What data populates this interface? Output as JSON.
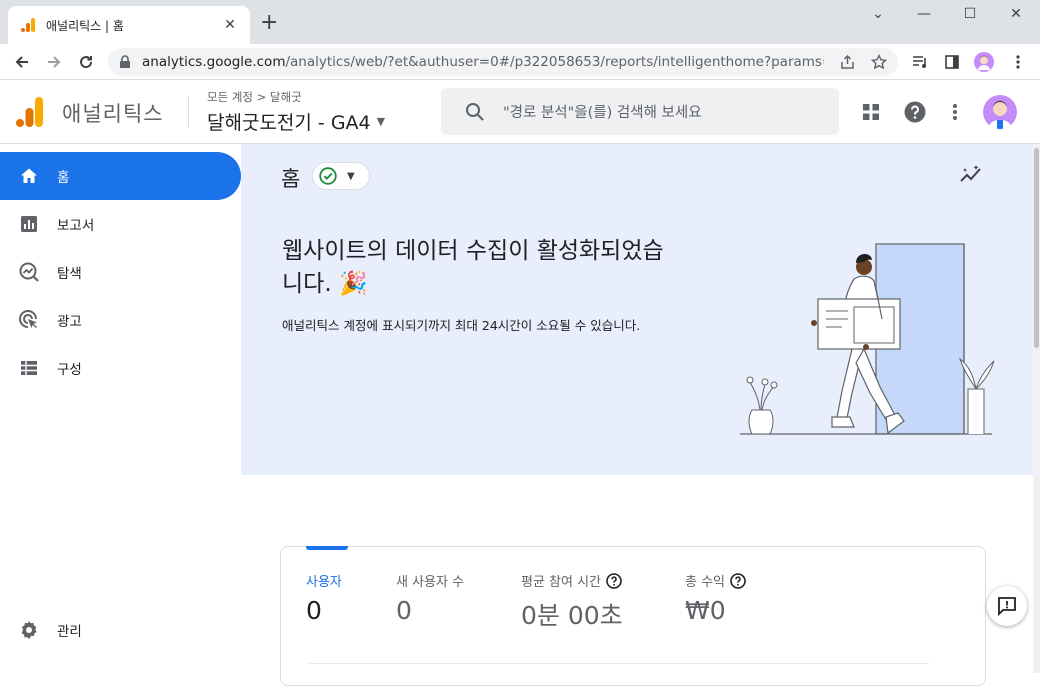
{
  "browser": {
    "tab_title": "애널리틱스 | 홈",
    "url_domain": "analytics.google.com",
    "url_path": "/analytics/web/?et&authuser=0#/p322058653/reports/intelligenthome?params=_u.n..."
  },
  "header": {
    "brand": "애널리틱스",
    "breadcrumb": "모든 계정 > 달해굿",
    "property": "달해굿도전기 - GA4",
    "search_placeholder": "\"경로 분석\"을(를) 검색해 보세요"
  },
  "sidebar": {
    "items": [
      {
        "label": "홈",
        "icon": "home-icon",
        "active": true
      },
      {
        "label": "보고서",
        "icon": "bar-chart-icon",
        "active": false
      },
      {
        "label": "탐색",
        "icon": "explore-icon",
        "active": false
      },
      {
        "label": "광고",
        "icon": "ads-icon",
        "active": false
      },
      {
        "label": "구성",
        "icon": "configure-icon",
        "active": false
      }
    ],
    "admin_label": "관리"
  },
  "main": {
    "title": "홈",
    "banner_headline": "웹사이트의 데이터 수집이 활성화되었습니다.",
    "banner_emoji": "🎉",
    "banner_subtext": "애널리틱스 계정에 표시되기까지 최대 24시간이 소요될 수 있습니다."
  },
  "metrics": [
    {
      "label": "사용자",
      "value": "0",
      "active": true,
      "help": false
    },
    {
      "label": "새 사용자 수",
      "value": "0",
      "active": false,
      "help": false
    },
    {
      "label": "평균 참여 시간",
      "value": "0분 00초",
      "active": false,
      "help": true
    },
    {
      "label": "총 수익",
      "value": "₩0",
      "active": false,
      "help": true
    }
  ],
  "colors": {
    "accent": "#1a73e8",
    "banner_bg": "#e8eefc",
    "logo_orange": "#f9ab00",
    "logo_dark": "#e37400",
    "status_green": "#1e8e3e"
  }
}
